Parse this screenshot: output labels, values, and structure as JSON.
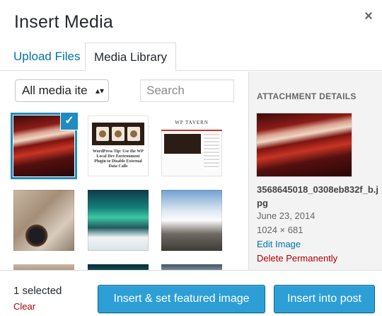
{
  "modal": {
    "title": "Insert Media",
    "close_glyph": "×"
  },
  "tabs": [
    {
      "label": "Upload Files",
      "active": false
    },
    {
      "label": "Media Library",
      "active": true
    }
  ],
  "filter": {
    "value": "All media ite",
    "arrow_glyph": "▴▾"
  },
  "search": {
    "placeholder": "Search"
  },
  "grid": {
    "items": [
      {
        "id": "item-1",
        "selected": true,
        "check_glyph": "✓"
      },
      {
        "id": "item-2",
        "selected": false,
        "caption": "WordPress Tip: Use the WP Local Dev Environment Plugin to Disable External Data Calls"
      },
      {
        "id": "item-3",
        "selected": false,
        "site": "WP TAVERN"
      },
      {
        "id": "item-4",
        "selected": false
      },
      {
        "id": "item-5",
        "selected": false
      },
      {
        "id": "item-6",
        "selected": false
      }
    ]
  },
  "details": {
    "heading": "Attachment Details",
    "filename": "3568645018_0308eb832f_b.jpg",
    "date": "June 23, 2014",
    "dimensions": "1024 × 681",
    "edit_label": "Edit Image",
    "delete_label": "Delete Permanently"
  },
  "toolbar": {
    "selected_count": "1 selected",
    "clear_label": "Clear",
    "featured_label": "Insert & set featured image",
    "insert_label": "Insert into post"
  },
  "colors": {
    "accent": "#0073aa",
    "primary_button": "#2d9fd6",
    "selected_outline": "#1e8cbe",
    "danger": "#aa0000"
  }
}
